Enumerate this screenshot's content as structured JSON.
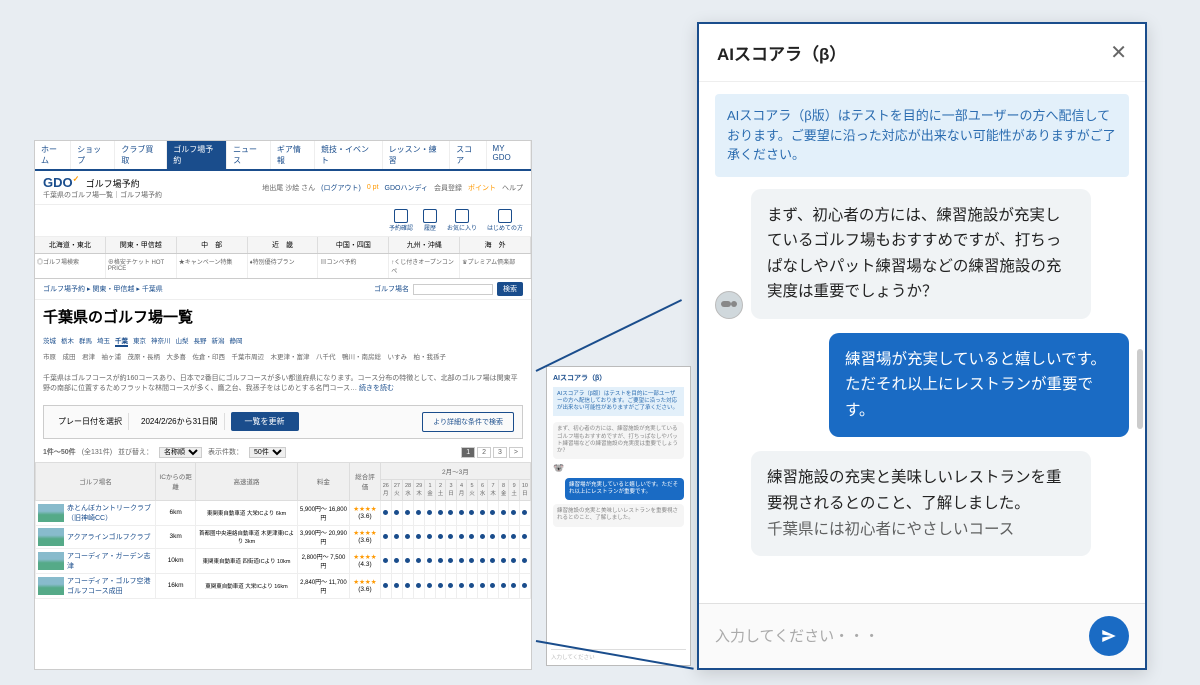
{
  "nav": [
    "ホーム",
    "ショップ",
    "クラブ買取",
    "ゴルフ場予約",
    "ニュース",
    "ギア情報",
    "競技・イベント",
    "レッスン・練習",
    "スコア",
    "MY GDO"
  ],
  "nav_active": 3,
  "logo": {
    "brand": "GDO",
    "title": "ゴルフ場予約",
    "sub": "千葉県のゴルフ場一覧｜ゴルフ場予約"
  },
  "user_line": {
    "name": "地出尾 沙絵 さん",
    "logout": "(ログアウト)",
    "points": "0 pt",
    "handy": "GDOハンディ",
    "member": "会員登録",
    "points_label": "ポイント",
    "help": "ヘルプ"
  },
  "header_icons": [
    "予約確認",
    "履歴",
    "お気に入り",
    "はじめての方"
  ],
  "regions": [
    "北海道・東北",
    "関東・甲信越",
    "中　部",
    "近　畿",
    "中国・四国",
    "九州・沖縄",
    "海　外"
  ],
  "promos": [
    "◎ゴルフ場検索",
    "⊕格安チケット HOT PRICE",
    "★キャンペーン特集",
    "♦特別優待プラン",
    "▤コンペ予約",
    "↑くじ付きオープンコンペ",
    "♛プレミアム倶楽部"
  ],
  "breadcrumb": [
    "ゴルフ場予約",
    "関東・甲信越",
    "千葉県"
  ],
  "search_label": "ゴルフ場名",
  "search_btn": "検索",
  "page_title": "千葉県のゴルフ場一覧",
  "area_tabs": [
    "茨城",
    "栃木",
    "群馬",
    "埼玉",
    "千葉",
    "東京",
    "神奈川",
    "山梨",
    "長野",
    "新潟",
    "静岡"
  ],
  "area_active": 4,
  "sub_areas": "市原　成田　君津　袖ヶ浦　茂原・長柄　大多喜　佐倉・印西　千葉市周辺　木更津・富津　八千代　鴨川・南房総　いすみ　柏・我孫子",
  "description": "千葉県はゴルフコースが約160コースあり、日本で2番目にゴルフコースが多い都道府県になります。コース分布の特徴として、北部のゴルフ場は関東平野の南部に位置するためフラットな林間コースが多く、鷹之台、我孫子をはじめとする名門コース…",
  "read_more": "続きを読む",
  "date_bar": {
    "label": "プレー日付を選択",
    "value": "2024/2/26から31日間",
    "update": "一覧を更新",
    "detail": "より詳細な条件で検索"
  },
  "list_header": {
    "count": "1件～50件",
    "total": "(全131件)",
    "sort_label": "並び替え：",
    "sort_value": "名称順",
    "perpage_label": "表示件数：",
    "perpage_value": "50件",
    "pages": [
      "1",
      "2",
      "3",
      ">"
    ]
  },
  "table_headers": [
    "ゴルフ場名",
    "ICからの距離",
    "高速道路",
    "料金",
    "総合評価"
  ],
  "month_header": "2月～3月",
  "days": [
    "26",
    "27",
    "28",
    "29",
    "1",
    "2",
    "3",
    "4",
    "5",
    "6",
    "7",
    "8",
    "9",
    "10"
  ],
  "weekdays": [
    "月",
    "火",
    "水",
    "木",
    "金",
    "土",
    "日",
    "月",
    "火",
    "水",
    "木",
    "金",
    "土",
    "日"
  ],
  "courses": [
    {
      "name": "赤とんぼカントリークラブ（旧神崎CC）",
      "km": "6km",
      "highway": "東関東自動車道 大栄ICより 6km",
      "price": "5,900円～ 16,800円",
      "rating": "(3.6)"
    },
    {
      "name": "アクアラインゴルフクラブ",
      "km": "3km",
      "highway": "首都圏中央連絡自動車道 木更津東ICより 3km",
      "price": "3,990円～ 20,990円",
      "rating": "(3.6)"
    },
    {
      "name": "アコーディア・ガーデン志津",
      "km": "10km",
      "highway": "東関東自動車道 四街道ICより 10km",
      "price": "2,800円～ 7,500円",
      "rating": "(4.3)"
    },
    {
      "name": "アコーディア・ゴルフ空港ゴルフコース成田",
      "km": "16km",
      "highway": "東関東自動車道 大栄ICより 16km",
      "price": "2,840円～ 11,700円",
      "rating": "(3.6)"
    }
  ],
  "chat": {
    "title": "AIスコアラ（β）",
    "notice": "AIスコアラ（β版）はテストを目的に一部ユーザーの方へ配信しております。ご要望に沿った対応が出来ない可能性がありますがご了承ください。",
    "bot1": "まず、初心者の方には、練習施設が充実しているゴルフ場もおすすめですが、打ちっぱなしやパット練習場などの練習施設の充実度は重要でしょうか？",
    "user1": "練習場が充実していると嬉しいです。ただそれ以上にレストランが重要です。",
    "bot2": "練習施設の充実と美味しいレストランを重要視されるとのこと、了解しました。",
    "bot2_cut": "千葉県には初心者にやさしいコース",
    "placeholder": "入力してください・・・",
    "small_input": "入力してください"
  }
}
